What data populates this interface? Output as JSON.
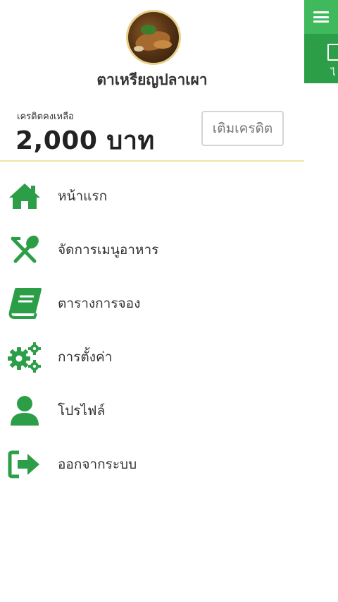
{
  "background_app": {
    "topbar_color": "#2c9e48",
    "menu_button_color": "#3fb95c",
    "menu_icon": "hamburger-icon",
    "calendar_icon": "calendar-icon",
    "partial_label": "ไ"
  },
  "profile": {
    "avatar": "food-photo-avatar",
    "name": "ตาเหรียญปลาเผา"
  },
  "credit": {
    "label": "เครดิตคงเหลือ",
    "amount": "2,000 บาท",
    "topup_label": "เติมเครดิต"
  },
  "accent_color": "#2c9e48",
  "divider_color": "#f0e4a6",
  "menu": {
    "items": [
      {
        "label": "หน้าแรก",
        "icon": "home-icon"
      },
      {
        "label": "จัดการเมนูอาหาร",
        "icon": "utensils-icon"
      },
      {
        "label": "ตารางการจอง",
        "icon": "book-icon"
      },
      {
        "label": "การตั้งค่า",
        "icon": "gears-icon"
      },
      {
        "label": "โปรไฟล์",
        "icon": "user-icon"
      },
      {
        "label": "ออกจากระบบ",
        "icon": "sign-out-icon"
      }
    ]
  }
}
